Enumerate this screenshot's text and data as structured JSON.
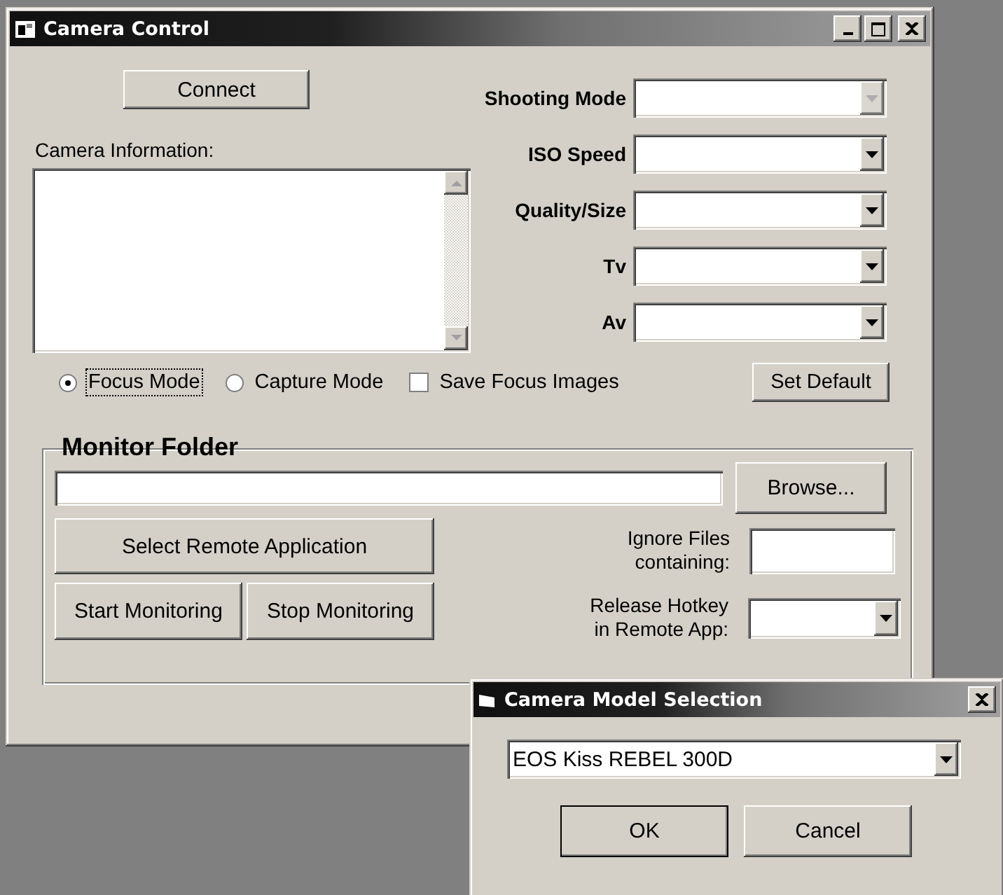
{
  "window": {
    "title": "Camera Control"
  },
  "connect_button": "Connect",
  "camera_information": {
    "label": "Camera Information:"
  },
  "settings": [
    {
      "label": "Shooting Mode",
      "disabled": true
    },
    {
      "label": "ISO Speed",
      "disabled": false
    },
    {
      "label": "Quality/Size",
      "disabled": false
    },
    {
      "label": "Tv",
      "disabled": false
    },
    {
      "label": "Av",
      "disabled": false
    }
  ],
  "modes": [
    {
      "label": "Focus Mode",
      "selected": true
    },
    {
      "label": "Capture Mode",
      "selected": false
    }
  ],
  "save_focus_images": {
    "label": "Save Focus Images",
    "checked": false
  },
  "set_default_button": "Set Default",
  "monitor_folder": {
    "title": "Monitor Folder",
    "browse_button": "Browse...",
    "select_remote_button": "Select Remote Application",
    "start_button": "Start Monitoring",
    "stop_button": "Stop Monitoring",
    "ignore_label": "Ignore Files containing:",
    "hotkey_label": "Release Hotkey in Remote App:"
  },
  "dialog": {
    "title": "Camera Model Selection",
    "model": "EOS Kiss REBEL 300D",
    "ok_button": "OK",
    "cancel_button": "Cancel"
  }
}
